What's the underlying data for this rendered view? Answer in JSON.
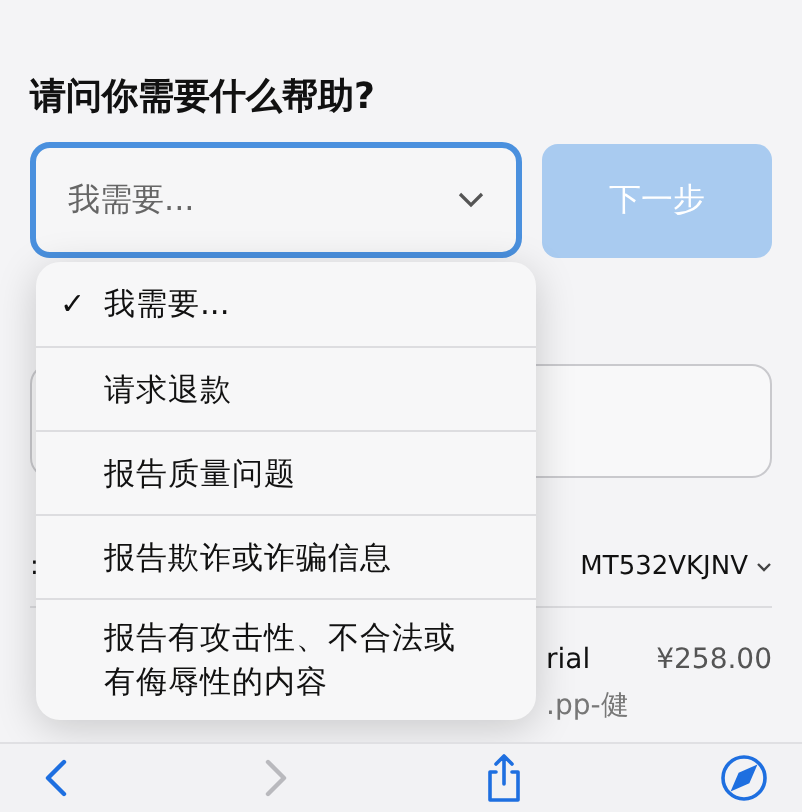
{
  "question": "请问你需要什么帮助?",
  "select": {
    "value": "我需要...",
    "focused": true
  },
  "next_button": {
    "label": "下一步",
    "disabled": true
  },
  "menu": {
    "open": true,
    "check": "✓",
    "options": [
      {
        "label": "我需要...",
        "selected": true
      },
      {
        "label": "请求退款",
        "selected": false
      },
      {
        "label": "报告质量问题",
        "selected": false
      },
      {
        "label": "报告欺诈或诈骗信息",
        "selected": false
      },
      {
        "label": "报告有攻击性、不合法或有侮辱性的内容",
        "selected": false
      }
    ]
  },
  "order": {
    "label": ":",
    "number": "MT532VKJNV"
  },
  "item": {
    "name": "rial",
    "subtitle": ".pp-健",
    "price": "¥258.00"
  },
  "toolbar": [
    {
      "kind": "back",
      "disabled": false
    },
    {
      "kind": "forward",
      "disabled": true
    },
    {
      "kind": "share",
      "disabled": false
    },
    {
      "kind": "compass",
      "disabled": false
    }
  ]
}
